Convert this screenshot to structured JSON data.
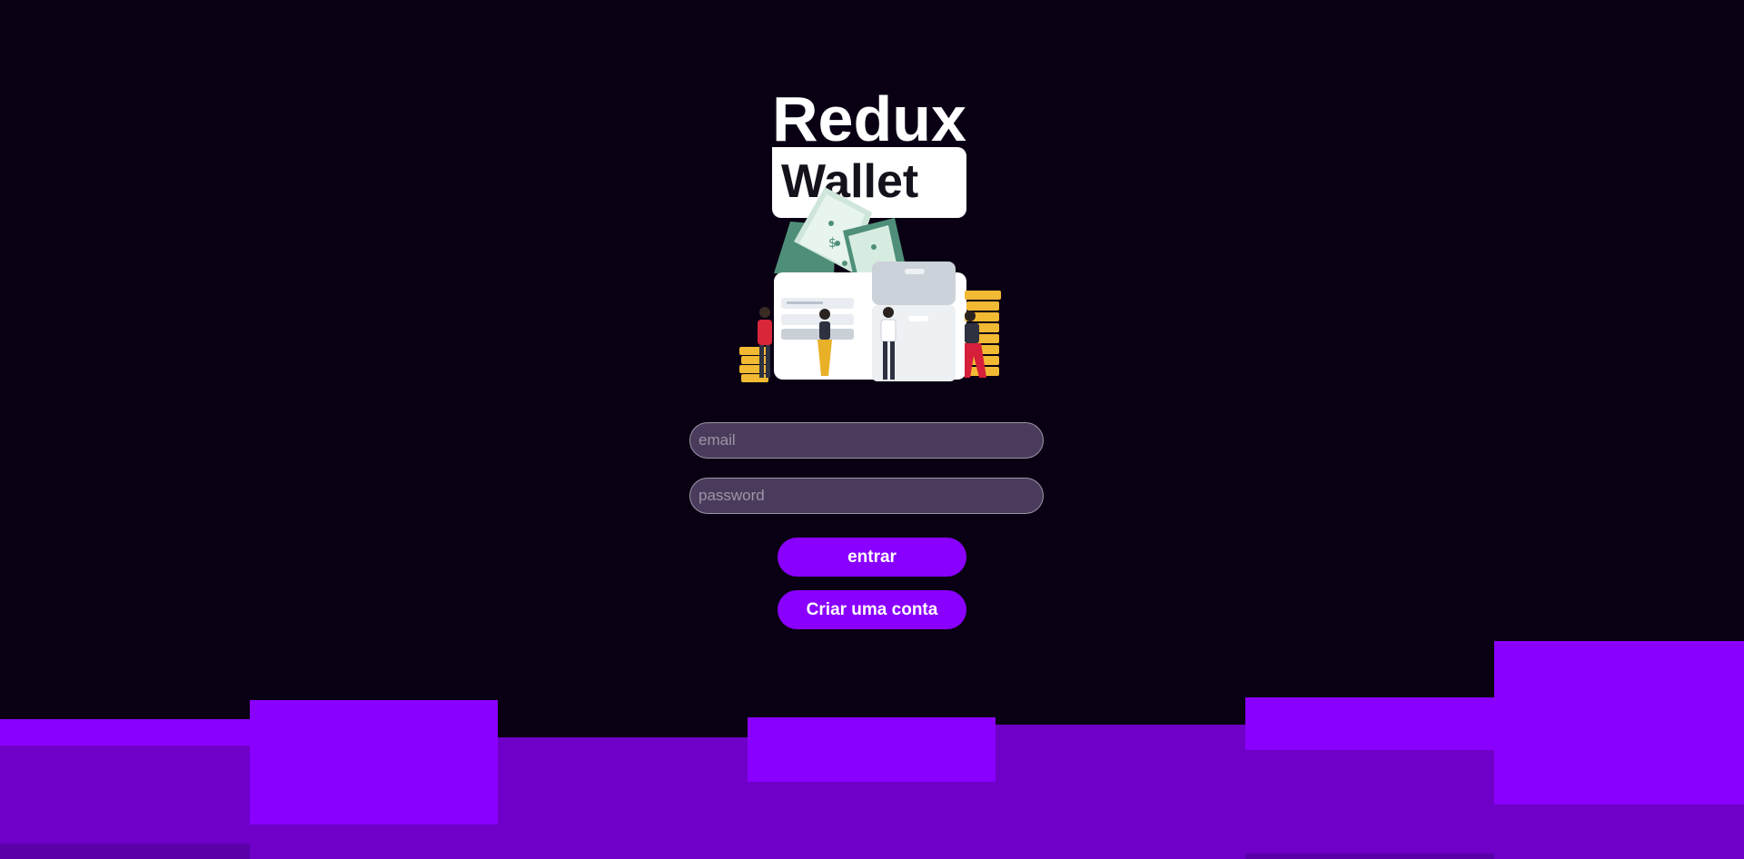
{
  "logo": {
    "line1": "Redux",
    "line2": "Wallet"
  },
  "illustration": {
    "icon": "wallet-money-people-illustration"
  },
  "form": {
    "email_placeholder": "email",
    "password_placeholder": "password",
    "login_label": "entrar",
    "signup_label": "Criar uma conta"
  },
  "colors": {
    "background": "#0a0014",
    "accent": "#8a00ff",
    "accent_dark": "#6e00c8",
    "input_bg": "#4a3b5c",
    "logo_box": "#ffffff"
  }
}
